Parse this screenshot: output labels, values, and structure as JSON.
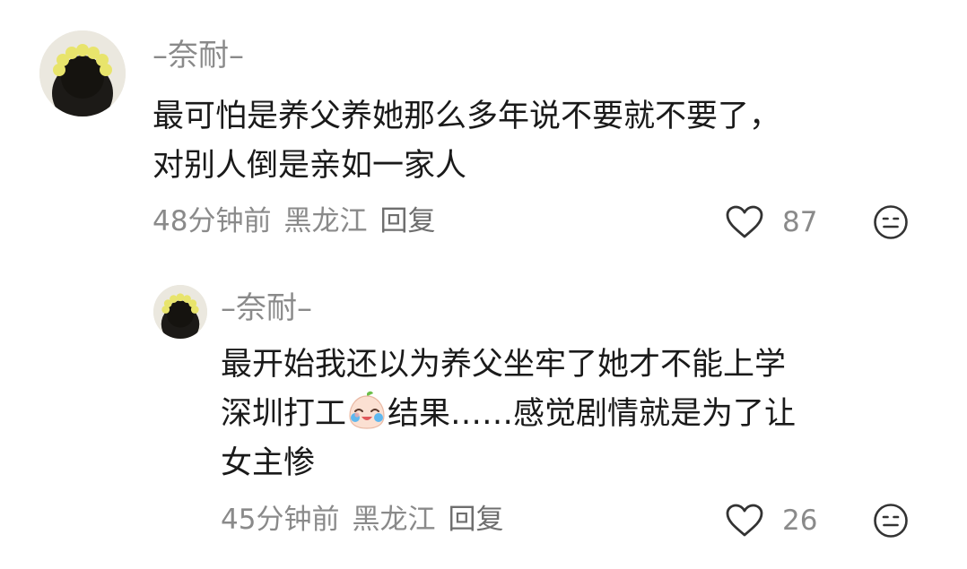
{
  "comments": [
    {
      "username": "–奈耐–",
      "text_lines": [
        "最可怕是养父养她那么多年说不要就不要了，",
        "对别人倒是亲如一家人"
      ],
      "time": "48分钟前",
      "location": "黑龙江",
      "reply_label": "回复",
      "like_count": "87"
    },
    {
      "username": "–奈耐–",
      "text_line1": "最开始我还以为养父坐牢了她才不能上学",
      "text_line2_before": "深圳打工",
      "text_line2_after": "结果……感觉剧情就是为了让",
      "text_line3": "女主惨",
      "time": "45分钟前",
      "location": "黑龙江",
      "reply_label": "回复",
      "like_count": "26"
    }
  ],
  "icons": {
    "like": "heart-outline-icon",
    "dislike": "neutral-face-icon",
    "emoji": "crying-laughing-bun-emoji"
  },
  "colors": {
    "text": "#1a1a1a",
    "meta": "#8a8a8a",
    "avatar_flowers": "#e6e36a"
  }
}
